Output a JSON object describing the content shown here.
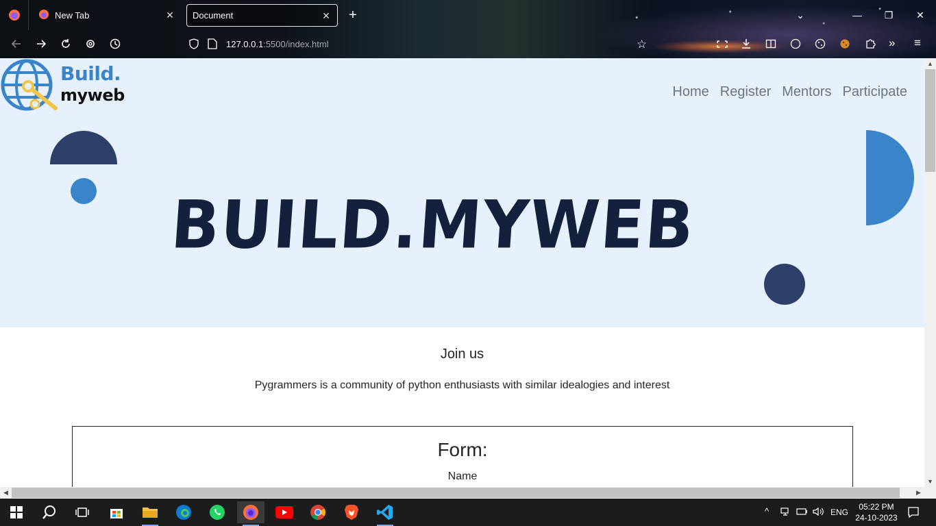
{
  "browser": {
    "tabs": [
      {
        "title": "New Tab",
        "active": false
      },
      {
        "title": "Document",
        "active": true
      }
    ],
    "url_host": "127.0.0.1",
    "url_rest": ":5500/index.html"
  },
  "site": {
    "logo": {
      "word1": "Build.",
      "word2": "myweb"
    },
    "nav": [
      {
        "label": "Home"
      },
      {
        "label": "Register"
      },
      {
        "label": "Mentors"
      },
      {
        "label": "Participate"
      }
    ],
    "hero_title": "BUILD.MYWEB",
    "join_title": "Join us",
    "join_description": "Pygrammers is a community of python enthusiasts with similar idealogies and interest",
    "form": {
      "title": "Form:",
      "first_label": "Name"
    },
    "colors": {
      "header_bg": "#e6f1fd",
      "accent_blue": "#3a84c9",
      "navy": "#2e3f6a",
      "title": "#14213d"
    }
  },
  "taskbar": {
    "language": "ENG",
    "time": "05:22 PM",
    "date": "24-10-2023",
    "apps": [
      "start-icon",
      "search-icon",
      "task-view-icon",
      "store-icon",
      "file-explorer-icon",
      "edge-icon",
      "whatsapp-icon",
      "firefox-icon",
      "youtube-icon",
      "chrome-icon",
      "brave-icon",
      "vscode-icon"
    ]
  }
}
